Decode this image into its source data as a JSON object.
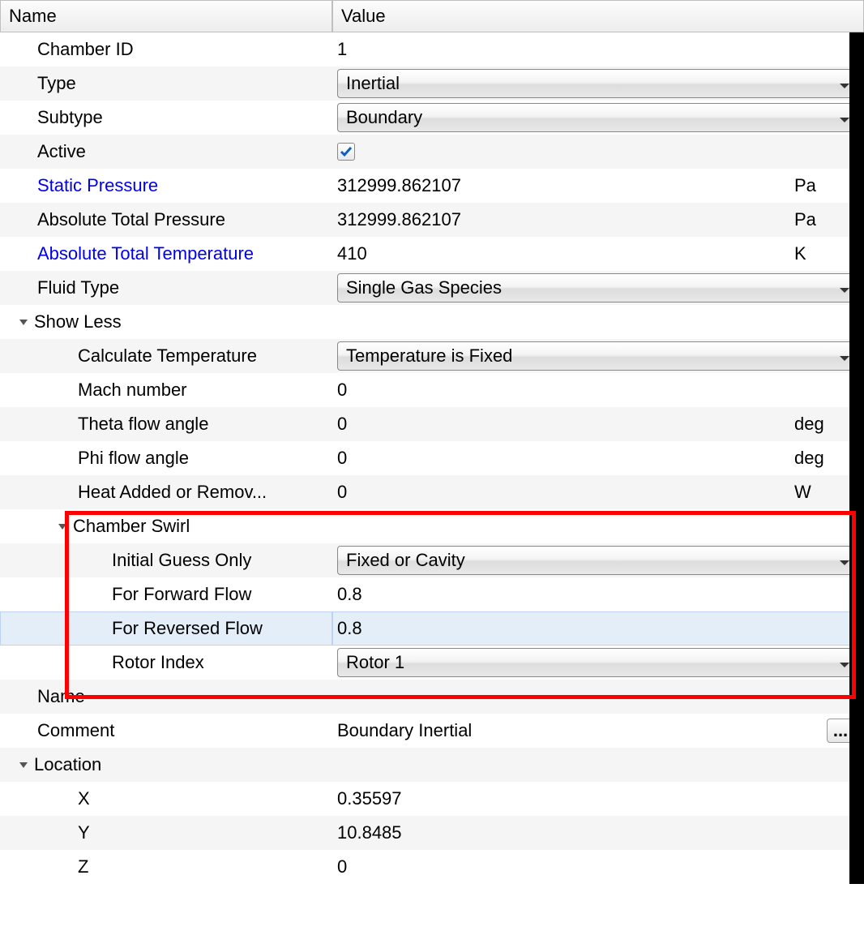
{
  "headers": {
    "name": "Name",
    "value": "Value"
  },
  "rows": {
    "chamber_id": {
      "label": "Chamber ID",
      "value": "1"
    },
    "type": {
      "label": "Type",
      "value": "Inertial"
    },
    "subtype": {
      "label": "Subtype",
      "value": "Boundary"
    },
    "active": {
      "label": "Active"
    },
    "static_p": {
      "label": "Static Pressure",
      "value": "312999.862107",
      "unit": "Pa"
    },
    "abs_tot_p": {
      "label": "Absolute Total Pressure",
      "value": "312999.862107",
      "unit": "Pa"
    },
    "abs_tot_t": {
      "label": "Absolute Total Temperature",
      "value": "410",
      "unit": "K"
    },
    "fluid_type": {
      "label": "Fluid Type",
      "value": "Single Gas Species"
    },
    "show_less": {
      "label": "Show Less"
    },
    "calc_temp": {
      "label": "Calculate Temperature",
      "value": "Temperature is Fixed"
    },
    "mach": {
      "label": "Mach number",
      "value": "0"
    },
    "theta": {
      "label": "Theta flow angle",
      "value": "0",
      "unit": "deg"
    },
    "phi": {
      "label": "Phi flow angle",
      "value": "0",
      "unit": "deg"
    },
    "heat": {
      "label": "Heat Added or Remov...",
      "value": "0",
      "unit": "W"
    },
    "chamber_swirl": {
      "label": "Chamber Swirl"
    },
    "init_guess": {
      "label": "Initial Guess Only",
      "value": "Fixed or Cavity"
    },
    "fwd_flow": {
      "label": "For Forward Flow",
      "value": "0.8"
    },
    "rev_flow": {
      "label": "For Reversed Flow",
      "value": "0.8"
    },
    "rotor_idx": {
      "label": "Rotor Index",
      "value": "Rotor 1"
    },
    "name2": {
      "label": "Name"
    },
    "comment": {
      "label": "Comment",
      "value": "Boundary Inertial"
    },
    "location": {
      "label": "Location"
    },
    "x": {
      "label": "X",
      "value": "0.35597"
    },
    "y": {
      "label": "Y",
      "value": "10.8485"
    },
    "z": {
      "label": "Z",
      "value": "0"
    }
  },
  "ellipsis": "..."
}
